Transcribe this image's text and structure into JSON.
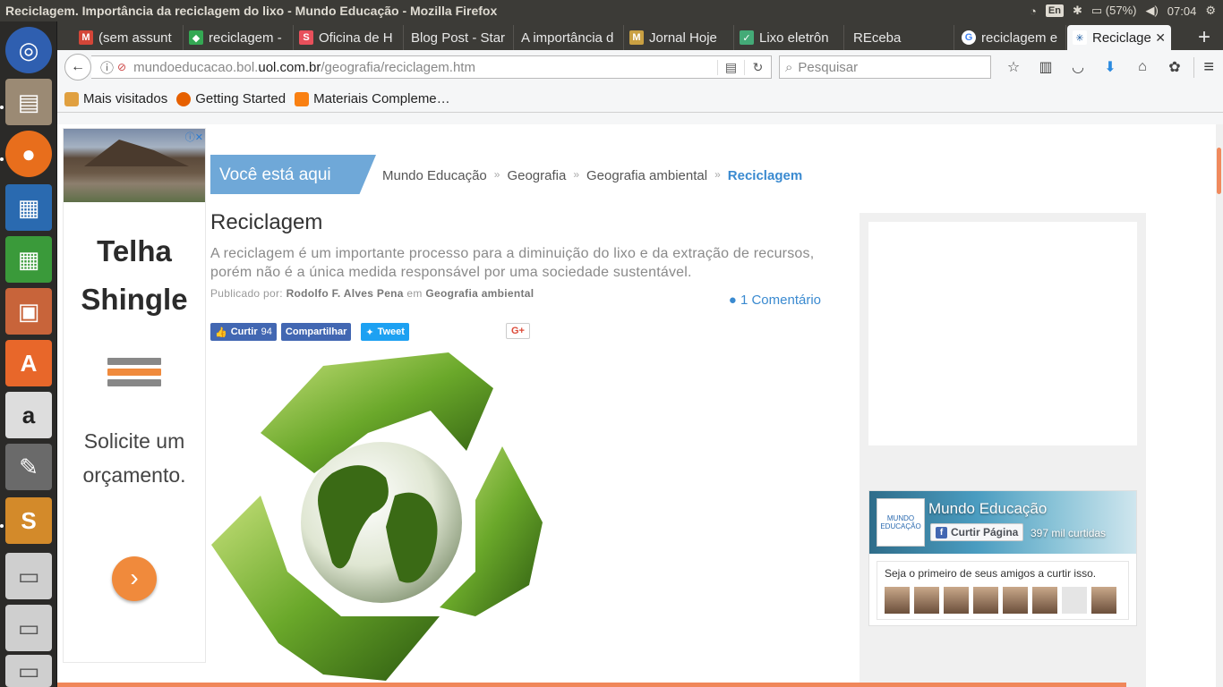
{
  "window": {
    "title": "Reciclagem. Importância da reciclagem do lixo - Mundo Educação - Mozilla Firefox",
    "tray": {
      "keyboard": "En",
      "battery": "(57%)",
      "time": "07:04"
    }
  },
  "tabs": [
    {
      "label": "(sem assunt",
      "favicon": "gmail-icon",
      "color": "#d44638",
      "glyph": "M"
    },
    {
      "label": "reciclagem -",
      "favicon": "maps-icon",
      "color": "#34a853",
      "glyph": "◆"
    },
    {
      "label": "Oficina de H",
      "favicon": "site-s-icon",
      "color": "#e8505b",
      "glyph": "S"
    },
    {
      "label": "Blog Post - Star",
      "favicon": "none",
      "color": "",
      "glyph": ""
    },
    {
      "label": "A importância d",
      "favicon": "none",
      "color": "",
      "glyph": ""
    },
    {
      "label": "Jornal Hoje",
      "favicon": "jornal-icon",
      "color": "#c9a042",
      "glyph": "M"
    },
    {
      "label": "Lixo eletrôn",
      "favicon": "bookmark-icon",
      "color": "#4a7",
      "glyph": "✓"
    },
    {
      "label": "REceba",
      "favicon": "none",
      "color": "",
      "glyph": ""
    },
    {
      "label": "reciclagem e",
      "favicon": "google-icon",
      "color": "#4285f4",
      "glyph": "G"
    },
    {
      "label": "Reciclage",
      "favicon": "mundo-educacao-icon",
      "color": "#1a5aa0",
      "glyph": "✳"
    }
  ],
  "nav": {
    "url_prefix": "mundoeducacao.bol.",
    "url_domain": "uol.com.br",
    "url_path": "/geografia/reciclagem.htm",
    "search_placeholder": "Pesquisar"
  },
  "bookmarks": [
    {
      "label": "Mais visitados",
      "icon": "folder-icon",
      "color": "#e0a040"
    },
    {
      "label": "Getting Started",
      "icon": "firefox-icon",
      "color": "#e66000"
    },
    {
      "label": "Materiais Compleme…",
      "icon": "moodle-icon",
      "color": "#f98012"
    }
  ],
  "ad": {
    "title": "Telha Shingle",
    "subtitle": "Solicite um orçamento.",
    "arrow": "›"
  },
  "breadcrumb": {
    "badge": "Você está aqui",
    "items": [
      "Mundo Educação",
      "Geografia",
      "Geografia ambiental"
    ],
    "current": "Reciclagem"
  },
  "article": {
    "title": "Reciclagem",
    "lead": "A reciclagem é um importante processo para a diminuição do lixo e da extração de recursos, porém não é a única medida responsável por uma sociedade sustentável.",
    "byline_prefix": "Publicado por:",
    "author": "Rodolfo F. Alves Pena",
    "byline_in": "em",
    "category": "Geografia ambiental",
    "comments": "1 Comentário"
  },
  "share": {
    "like": "Curtir",
    "like_count": "94",
    "share": "Compartilhar",
    "tweet": "Tweet",
    "gplus": "G+"
  },
  "facebook_widget": {
    "page_name": "Mundo Educação",
    "like_button": "Curtir Página",
    "likes": "397 mil curtidas",
    "friends_text": "Seja o primeiro de seus amigos a curtir isso.",
    "logo_text": "MUNDO EDUCAÇÃO"
  },
  "colors": {
    "accent_blue": "#3a8ad0",
    "badge_blue": "#6fa8d8",
    "orange": "#f08a3c",
    "recycle_green": "#5d9b1f"
  }
}
